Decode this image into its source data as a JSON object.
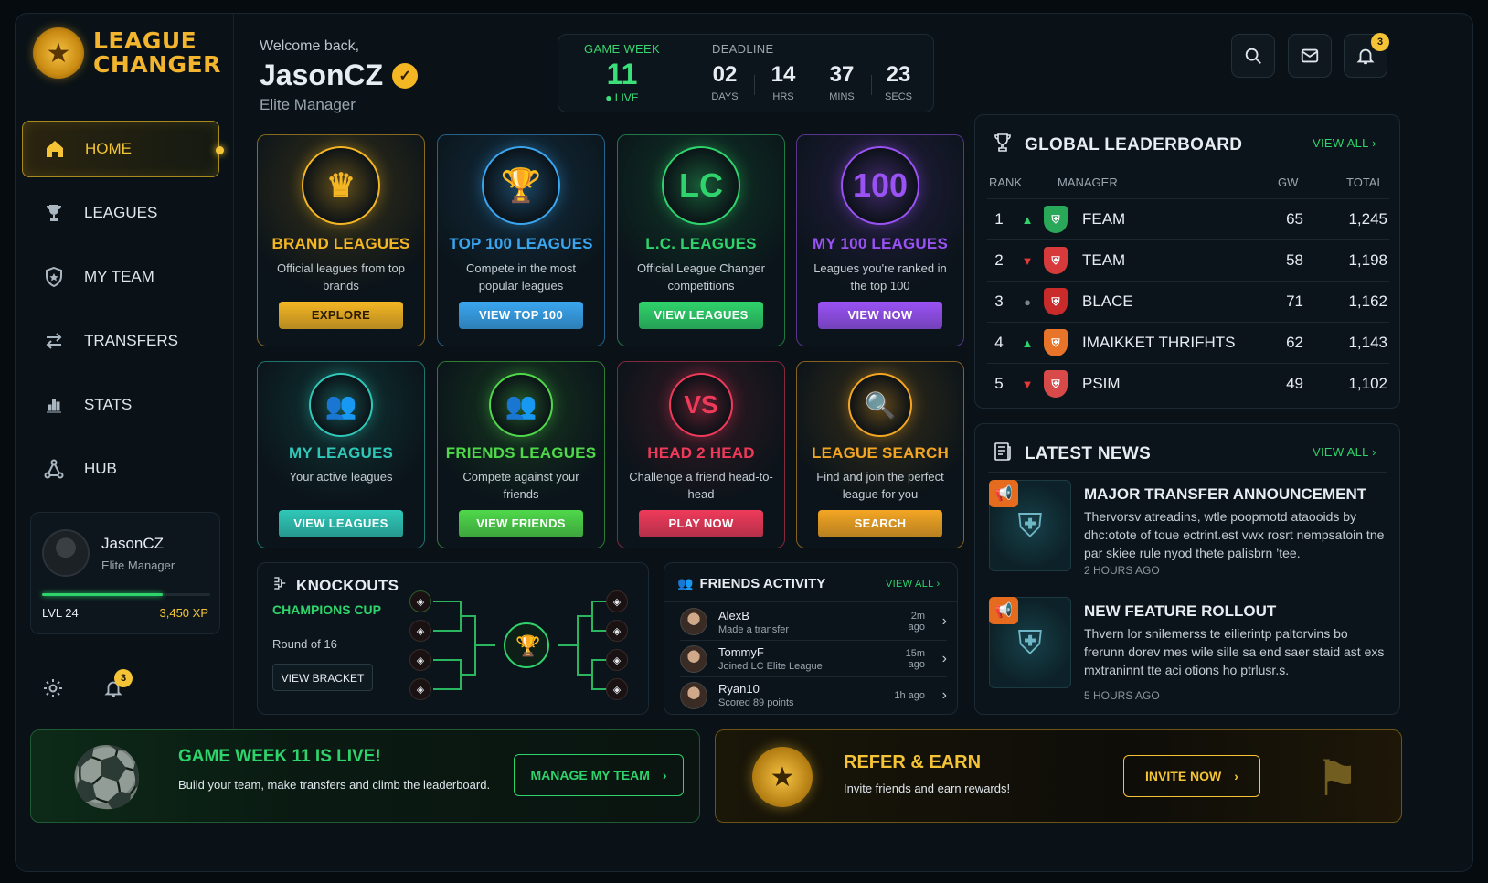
{
  "brand": {
    "line1": "LEAGUE",
    "line2": "CHANGER"
  },
  "nav": [
    {
      "label": "HOME",
      "icon": "home-icon",
      "active": true
    },
    {
      "label": "LEAGUES",
      "icon": "trophy-icon"
    },
    {
      "label": "MY TEAM",
      "icon": "shield-icon"
    },
    {
      "label": "TRANSFERS",
      "icon": "transfer-arrows-icon"
    },
    {
      "label": "STATS",
      "icon": "bar-chart-icon"
    },
    {
      "label": "HUB",
      "icon": "network-icon"
    }
  ],
  "profile": {
    "name": "JasonCZ",
    "role": "Elite Manager",
    "level": "LVL 24",
    "xp": "3,450 XP",
    "xp_progress": 0.72
  },
  "sidebar_notifications": "3",
  "welcome": {
    "greeting": "Welcome back,",
    "name": "JasonCZ",
    "role": "Elite Manager"
  },
  "gameweek": {
    "label": "GAME WEEK",
    "number": "11",
    "status": "LIVE"
  },
  "deadline": {
    "label": "DEADLINE",
    "units": [
      {
        "value": "02",
        "unit": "DAYS"
      },
      {
        "value": "14",
        "unit": "HRS"
      },
      {
        "value": "37",
        "unit": "MINS"
      },
      {
        "value": "23",
        "unit": "SECS"
      }
    ]
  },
  "header_notifications": "3",
  "cards": [
    {
      "title": "BRAND LEAGUES",
      "desc": "Official leagues from top brands",
      "button": "EXPLORE",
      "accent": "#f4b623",
      "glyph": "♛"
    },
    {
      "title": "TOP 100 LEAGUES",
      "desc": "Compete in the most popular leagues",
      "button": "VIEW TOP 100",
      "accent": "#3aa6ef",
      "glyph": "🏆"
    },
    {
      "title": "L.C. LEAGUES",
      "desc": "Official League Changer competitions",
      "button": "VIEW LEAGUES",
      "accent": "#2fd36b",
      "glyph": "LC"
    },
    {
      "title": "MY 100 LEAGUES",
      "desc": "Leagues you're ranked in the top 100",
      "button": "VIEW NOW",
      "accent": "#9a52f4",
      "glyph": "100"
    },
    {
      "title": "MY LEAGUES",
      "desc": "Your active leagues",
      "button": "VIEW LEAGUES",
      "accent": "#2fc8b8",
      "glyph": "👥"
    },
    {
      "title": "FRIENDS LEAGUES",
      "desc": "Compete against your friends",
      "button": "VIEW FRIENDS",
      "accent": "#4fd84a",
      "glyph": "👥"
    },
    {
      "title": "HEAD 2 HEAD",
      "desc": "Challenge a friend head-to-head",
      "button": "PLAY NOW",
      "accent": "#ef3a5a",
      "glyph": "VS"
    },
    {
      "title": "LEAGUE SEARCH",
      "desc": "Find and join the perfect league for you",
      "button": "SEARCH",
      "accent": "#f4a623",
      "glyph": "🔍"
    }
  ],
  "knockouts": {
    "title": "KNOCKOUTS",
    "cup": "CHAMPIONS CUP",
    "round": "Round of 16",
    "button": "VIEW BRACKET"
  },
  "friends": {
    "title": "FRIENDS ACTIVITY",
    "view_all": "VIEW ALL",
    "items": [
      {
        "name": "AlexB",
        "action": "Made a transfer",
        "time": "2m ago"
      },
      {
        "name": "TommyF",
        "action": "Joined LC Elite League",
        "time": "15m ago"
      },
      {
        "name": "Ryan10",
        "action": "Scored 89 points",
        "time": "1h ago"
      }
    ]
  },
  "leaderboard": {
    "title": "GLOBAL LEADERBOARD",
    "view_all": "VIEW ALL",
    "headers": {
      "rank": "RANK",
      "manager": "MANAGER",
      "gw": "GW",
      "total": "TOTAL"
    },
    "rows": [
      {
        "rank": "1",
        "trend": "up",
        "manager": "FEAM",
        "gw": "65",
        "total": "1,245",
        "color": "#2aa85a"
      },
      {
        "rank": "2",
        "trend": "down",
        "manager": "TEAM",
        "gw": "58",
        "total": "1,198",
        "color": "#d63a3a"
      },
      {
        "rank": "3",
        "trend": "same",
        "manager": "BLACE",
        "gw": "71",
        "total": "1,162",
        "color": "#c92a2a"
      },
      {
        "rank": "4",
        "trend": "up",
        "manager": "IMAIKKET THRIFHTS",
        "gw": "62",
        "total": "1,143",
        "color": "#e8742a"
      },
      {
        "rank": "5",
        "trend": "down",
        "manager": "PSIM",
        "gw": "49",
        "total": "1,102",
        "color": "#d84a4a"
      }
    ]
  },
  "news": {
    "title": "LATEST NEWS",
    "view_all": "VIEW ALL",
    "items": [
      {
        "headline": "MAJOR TRANSFER ANNOUNCEMENT",
        "body": "Thervorsv atreadins, wtle poopmotd ataooids by dhc:otote of toue ectrint.est vwx rosrt nempsatoin tne par skiee rule nyod thete palisbrn ’tee.",
        "time": "2 HOURS AGO"
      },
      {
        "headline": "NEW FEATURE ROLLOUT",
        "body": "Thvern lor snilemerss te eilierintp paltorvins bo frerunn dorev mes wile sille sa end saer staid ast exs mxtraninnt tte aci otions ho ptrlusr.s.",
        "time": "5 HOURS AGO"
      }
    ]
  },
  "banner_gw": {
    "title": "GAME WEEK 11 IS LIVE!",
    "subtitle": "Build your team, make transfers and climb the leaderboard.",
    "button": "MANAGE MY TEAM"
  },
  "banner_refer": {
    "title": "REFER & EARN",
    "subtitle": "Invite friends and earn rewards!",
    "button": "INVITE NOW"
  }
}
